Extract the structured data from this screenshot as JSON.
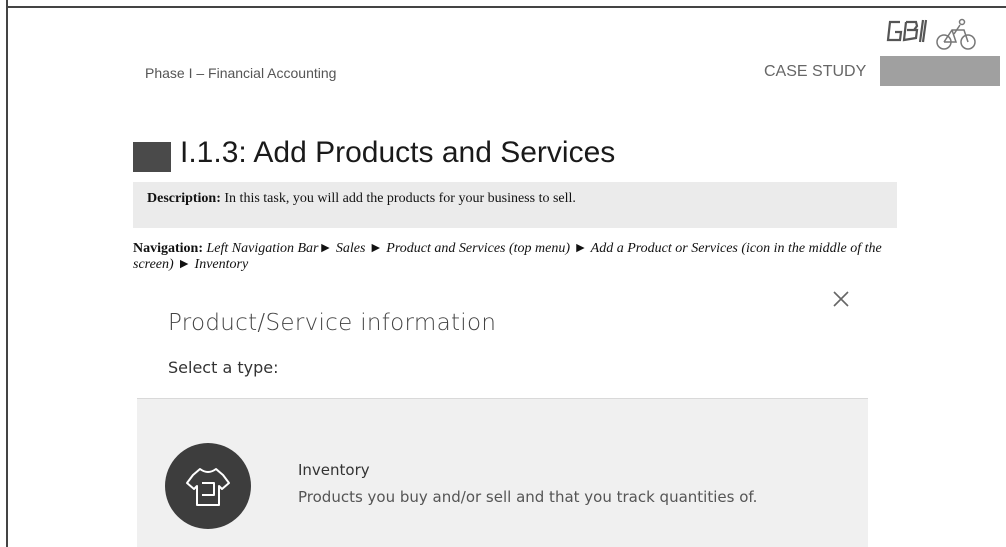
{
  "header": {
    "phase": "Phase I – Financial Accounting",
    "case_study": "CASE STUDY",
    "logo_alt": "GBI"
  },
  "task": {
    "title": "I.1.3: Add Products and Services",
    "description_label": "Description:",
    "description_text": " In this task, you will add the products for your business to sell."
  },
  "navigation": {
    "label": "Navigation:",
    "step1": " Left Navigation Bar",
    "step2": " Sales ",
    "step3": " Product and Services (top menu) ",
    "step4": " Add a Product or Services (icon in the middle of the screen) ",
    "step5": " Inventory",
    "arrow": "►"
  },
  "modal": {
    "title": "Product/Service information",
    "subtitle": "Select a type:",
    "option": {
      "title": "Inventory",
      "description": "Products you buy and/or sell and that you track quantities of.",
      "icon": "tshirt-icon"
    },
    "close_icon": "close-icon"
  },
  "colors": {
    "title_square": "#4a4a4a",
    "desc_bg": "#ebebeb",
    "card_bg": "#f0f0f0",
    "icon_circle": "#3d3d3d",
    "case_bar": "#a0a0a0"
  }
}
